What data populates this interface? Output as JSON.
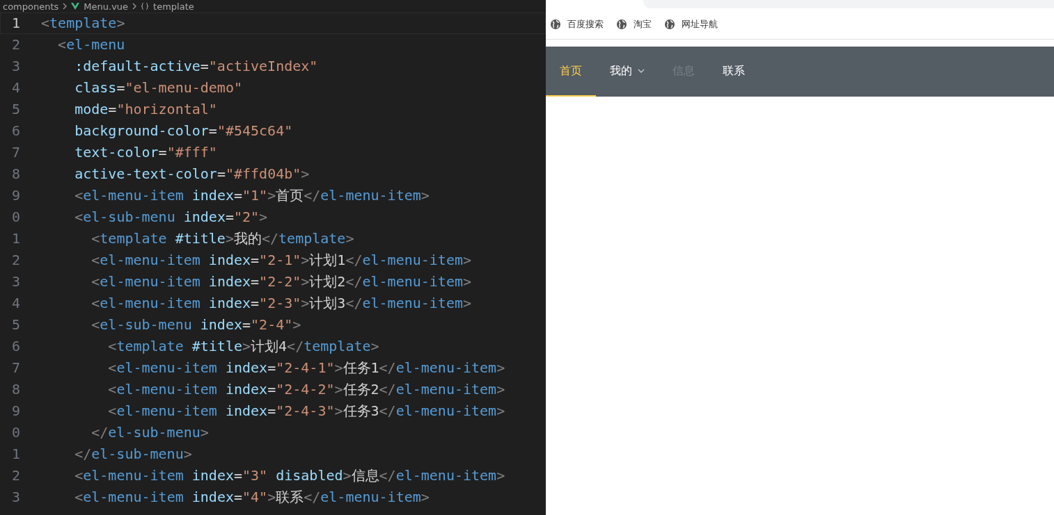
{
  "breadcrumb": [
    "components",
    "Menu.vue",
    "template"
  ],
  "code_lines": [
    {
      "number": "1",
      "current": true,
      "tokens": [
        {
          "kind": "p",
          "text": "<"
        },
        {
          "kind": "t",
          "text": "template"
        },
        {
          "kind": "p",
          "text": ">"
        }
      ]
    },
    {
      "number": "2",
      "current": false,
      "tokens": [
        {
          "kind": "p",
          "text": "  <"
        },
        {
          "kind": "t",
          "text": "el-menu"
        }
      ]
    },
    {
      "number": "3",
      "current": false,
      "tokens": [
        {
          "kind": "a",
          "text": "    :default-active"
        },
        {
          "kind": "x",
          "text": "="
        },
        {
          "kind": "s",
          "text": "\"activeIndex\""
        }
      ]
    },
    {
      "number": "4",
      "current": false,
      "tokens": [
        {
          "kind": "a",
          "text": "    class"
        },
        {
          "kind": "x",
          "text": "="
        },
        {
          "kind": "s",
          "text": "\"el-menu-demo\""
        }
      ]
    },
    {
      "number": "5",
      "current": false,
      "tokens": [
        {
          "kind": "a",
          "text": "    mode"
        },
        {
          "kind": "x",
          "text": "="
        },
        {
          "kind": "s",
          "text": "\"horizontal\""
        }
      ]
    },
    {
      "number": "6",
      "current": false,
      "tokens": [
        {
          "kind": "a",
          "text": "    background-color"
        },
        {
          "kind": "x",
          "text": "="
        },
        {
          "kind": "s",
          "text": "\"#545c64\""
        }
      ]
    },
    {
      "number": "7",
      "current": false,
      "tokens": [
        {
          "kind": "a",
          "text": "    text-color"
        },
        {
          "kind": "x",
          "text": "="
        },
        {
          "kind": "s",
          "text": "\"#fff\""
        }
      ]
    },
    {
      "number": "8",
      "current": false,
      "tokens": [
        {
          "kind": "a",
          "text": "    active-text-color"
        },
        {
          "kind": "x",
          "text": "="
        },
        {
          "kind": "s",
          "text": "\"#ffd04b\""
        },
        {
          "kind": "p",
          "text": ">"
        }
      ]
    },
    {
      "number": "9",
      "current": false,
      "tokens": [
        {
          "kind": "p",
          "text": "    <"
        },
        {
          "kind": "t",
          "text": "el-menu-item"
        },
        {
          "kind": "a",
          "text": " index"
        },
        {
          "kind": "x",
          "text": "="
        },
        {
          "kind": "s",
          "text": "\"1\""
        },
        {
          "kind": "p",
          "text": ">"
        },
        {
          "kind": "x",
          "text": "首页"
        },
        {
          "kind": "p",
          "text": "</"
        },
        {
          "kind": "t",
          "text": "el-menu-item"
        },
        {
          "kind": "p",
          "text": ">"
        }
      ]
    },
    {
      "number": "0",
      "current": false,
      "tokens": [
        {
          "kind": "p",
          "text": "    <"
        },
        {
          "kind": "t",
          "text": "el-sub-menu"
        },
        {
          "kind": "a",
          "text": " index"
        },
        {
          "kind": "x",
          "text": "="
        },
        {
          "kind": "s",
          "text": "\"2\""
        },
        {
          "kind": "p",
          "text": ">"
        }
      ]
    },
    {
      "number": "1",
      "current": false,
      "tokens": [
        {
          "kind": "p",
          "text": "      <"
        },
        {
          "kind": "t",
          "text": "template"
        },
        {
          "kind": "a",
          "text": " #title"
        },
        {
          "kind": "p",
          "text": ">"
        },
        {
          "kind": "x",
          "text": "我的"
        },
        {
          "kind": "p",
          "text": "</"
        },
        {
          "kind": "t",
          "text": "template"
        },
        {
          "kind": "p",
          "text": ">"
        }
      ]
    },
    {
      "number": "2",
      "current": false,
      "tokens": [
        {
          "kind": "p",
          "text": "      <"
        },
        {
          "kind": "t",
          "text": "el-menu-item"
        },
        {
          "kind": "a",
          "text": " index"
        },
        {
          "kind": "x",
          "text": "="
        },
        {
          "kind": "s",
          "text": "\"2-1\""
        },
        {
          "kind": "p",
          "text": ">"
        },
        {
          "kind": "x",
          "text": "计划1"
        },
        {
          "kind": "p",
          "text": "</"
        },
        {
          "kind": "t",
          "text": "el-menu-item"
        },
        {
          "kind": "p",
          "text": ">"
        }
      ]
    },
    {
      "number": "3",
      "current": false,
      "tokens": [
        {
          "kind": "p",
          "text": "      <"
        },
        {
          "kind": "t",
          "text": "el-menu-item"
        },
        {
          "kind": "a",
          "text": " index"
        },
        {
          "kind": "x",
          "text": "="
        },
        {
          "kind": "s",
          "text": "\"2-2\""
        },
        {
          "kind": "p",
          "text": ">"
        },
        {
          "kind": "x",
          "text": "计划2"
        },
        {
          "kind": "p",
          "text": "</"
        },
        {
          "kind": "t",
          "text": "el-menu-item"
        },
        {
          "kind": "p",
          "text": ">"
        }
      ]
    },
    {
      "number": "4",
      "current": false,
      "tokens": [
        {
          "kind": "p",
          "text": "      <"
        },
        {
          "kind": "t",
          "text": "el-menu-item"
        },
        {
          "kind": "a",
          "text": " index"
        },
        {
          "kind": "x",
          "text": "="
        },
        {
          "kind": "s",
          "text": "\"2-3\""
        },
        {
          "kind": "p",
          "text": ">"
        },
        {
          "kind": "x",
          "text": "计划3"
        },
        {
          "kind": "p",
          "text": "</"
        },
        {
          "kind": "t",
          "text": "el-menu-item"
        },
        {
          "kind": "p",
          "text": ">"
        }
      ]
    },
    {
      "number": "5",
      "current": false,
      "tokens": [
        {
          "kind": "p",
          "text": "      <"
        },
        {
          "kind": "t",
          "text": "el-sub-menu"
        },
        {
          "kind": "a",
          "text": " index"
        },
        {
          "kind": "x",
          "text": "="
        },
        {
          "kind": "s",
          "text": "\"2-4\""
        },
        {
          "kind": "p",
          "text": ">"
        }
      ]
    },
    {
      "number": "6",
      "current": false,
      "tokens": [
        {
          "kind": "p",
          "text": "        <"
        },
        {
          "kind": "t",
          "text": "template"
        },
        {
          "kind": "a",
          "text": " #title"
        },
        {
          "kind": "p",
          "text": ">"
        },
        {
          "kind": "x",
          "text": "计划4"
        },
        {
          "kind": "p",
          "text": "</"
        },
        {
          "kind": "t",
          "text": "template"
        },
        {
          "kind": "p",
          "text": ">"
        }
      ]
    },
    {
      "number": "7",
      "current": false,
      "tokens": [
        {
          "kind": "p",
          "text": "        <"
        },
        {
          "kind": "t",
          "text": "el-menu-item"
        },
        {
          "kind": "a",
          "text": " index"
        },
        {
          "kind": "x",
          "text": "="
        },
        {
          "kind": "s",
          "text": "\"2-4-1\""
        },
        {
          "kind": "p",
          "text": ">"
        },
        {
          "kind": "x",
          "text": "任务1"
        },
        {
          "kind": "p",
          "text": "</"
        },
        {
          "kind": "t",
          "text": "el-menu-item"
        },
        {
          "kind": "p",
          "text": ">"
        }
      ]
    },
    {
      "number": "8",
      "current": false,
      "tokens": [
        {
          "kind": "p",
          "text": "        <"
        },
        {
          "kind": "t",
          "text": "el-menu-item"
        },
        {
          "kind": "a",
          "text": " index"
        },
        {
          "kind": "x",
          "text": "="
        },
        {
          "kind": "s",
          "text": "\"2-4-2\""
        },
        {
          "kind": "p",
          "text": ">"
        },
        {
          "kind": "x",
          "text": "任务2"
        },
        {
          "kind": "p",
          "text": "</"
        },
        {
          "kind": "t",
          "text": "el-menu-item"
        },
        {
          "kind": "p",
          "text": ">"
        }
      ]
    },
    {
      "number": "9",
      "current": false,
      "tokens": [
        {
          "kind": "p",
          "text": "        <"
        },
        {
          "kind": "t",
          "text": "el-menu-item"
        },
        {
          "kind": "a",
          "text": " index"
        },
        {
          "kind": "x",
          "text": "="
        },
        {
          "kind": "s",
          "text": "\"2-4-3\""
        },
        {
          "kind": "p",
          "text": ">"
        },
        {
          "kind": "x",
          "text": "任务3"
        },
        {
          "kind": "p",
          "text": "</"
        },
        {
          "kind": "t",
          "text": "el-menu-item"
        },
        {
          "kind": "p",
          "text": ">"
        }
      ]
    },
    {
      "number": "0",
      "current": false,
      "tokens": [
        {
          "kind": "p",
          "text": "      </"
        },
        {
          "kind": "t",
          "text": "el-sub-menu"
        },
        {
          "kind": "p",
          "text": ">"
        }
      ]
    },
    {
      "number": "1",
      "current": false,
      "tokens": [
        {
          "kind": "p",
          "text": "    </"
        },
        {
          "kind": "t",
          "text": "el-sub-menu"
        },
        {
          "kind": "p",
          "text": ">"
        }
      ]
    },
    {
      "number": "2",
      "current": false,
      "tokens": [
        {
          "kind": "p",
          "text": "    <"
        },
        {
          "kind": "t",
          "text": "el-menu-item"
        },
        {
          "kind": "a",
          "text": " index"
        },
        {
          "kind": "x",
          "text": "="
        },
        {
          "kind": "s",
          "text": "\"3\""
        },
        {
          "kind": "a",
          "text": " disabled"
        },
        {
          "kind": "p",
          "text": ">"
        },
        {
          "kind": "x",
          "text": "信息"
        },
        {
          "kind": "p",
          "text": "</"
        },
        {
          "kind": "t",
          "text": "el-menu-item"
        },
        {
          "kind": "p",
          "text": ">"
        }
      ]
    },
    {
      "number": "3",
      "current": false,
      "tokens": [
        {
          "kind": "p",
          "text": "    <"
        },
        {
          "kind": "t",
          "text": "el-menu-item"
        },
        {
          "kind": "a",
          "text": " index"
        },
        {
          "kind": "x",
          "text": "="
        },
        {
          "kind": "s",
          "text": "\"4\""
        },
        {
          "kind": "p",
          "text": ">"
        },
        {
          "kind": "x",
          "text": "联系"
        },
        {
          "kind": "p",
          "text": "</"
        },
        {
          "kind": "t",
          "text": "el-menu-item"
        },
        {
          "kind": "p",
          "text": ">"
        }
      ]
    }
  ],
  "bookmarks": [
    "百度搜索",
    "淘宝",
    "网址导航"
  ],
  "menu": [
    {
      "label": "首页",
      "kind": "item",
      "selected": true,
      "disabled": false
    },
    {
      "label": "我的",
      "kind": "submenu",
      "selected": false,
      "disabled": false
    },
    {
      "label": "信息",
      "kind": "item",
      "selected": false,
      "disabled": true
    },
    {
      "label": "联系",
      "kind": "item",
      "selected": false,
      "disabled": false
    }
  ]
}
